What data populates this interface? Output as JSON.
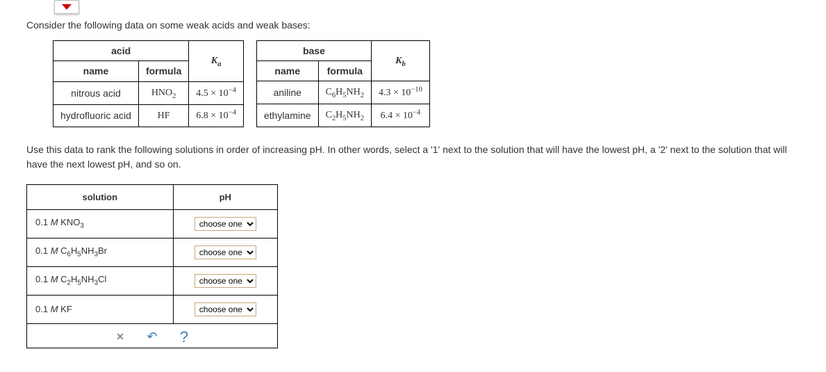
{
  "intro": "Consider the following data on some weak acids and weak bases:",
  "acid_table": {
    "group_header": "acid",
    "col_name": "name",
    "col_formula": "formula",
    "col_k": "K_a",
    "rows": [
      {
        "name": "nitrous acid",
        "formula": "HNO_2",
        "k": "4.5 × 10^{-4}"
      },
      {
        "name": "hydrofluoric acid",
        "formula": "HF",
        "k": "6.8 × 10^{-4}"
      }
    ]
  },
  "base_table": {
    "group_header": "base",
    "col_name": "name",
    "col_formula": "formula",
    "col_k": "K_b",
    "rows": [
      {
        "name": "aniline",
        "formula": "C_6H_5NH_2",
        "k": "4.3 × 10^{-10}"
      },
      {
        "name": "ethylamine",
        "formula": "C_2H_5NH_2",
        "k": "6.4 × 10^{-4}"
      }
    ]
  },
  "instructions": "Use this data to rank the following solutions in order of increasing pH. In other words, select a '1' next to the solution that will have the lowest pH, a '2' next to the solution that will have the next lowest pH, and so on.",
  "solution_table": {
    "col_solution": "solution",
    "col_ph": "pH",
    "placeholder": "choose one",
    "rows": [
      {
        "label": "0.1 M KNO_3"
      },
      {
        "label": "0.1 M C_6H_5NH_3Br"
      },
      {
        "label": "0.1 M C_2H_5NH_3Cl"
      },
      {
        "label": "0.1 M KF"
      }
    ]
  },
  "actions": {
    "clear": "clear",
    "undo": "undo",
    "help": "help"
  }
}
